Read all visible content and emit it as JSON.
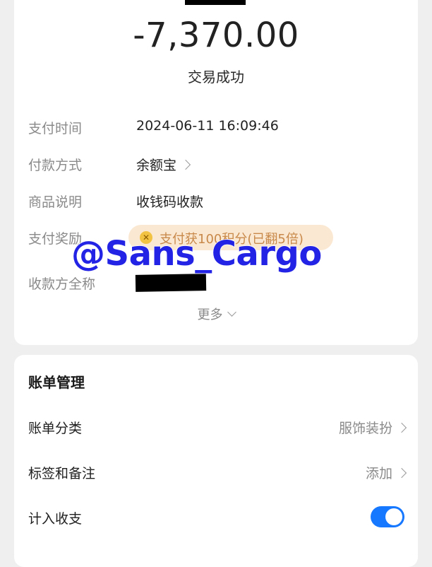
{
  "transaction": {
    "amount": "-7,370.00",
    "status": "交易成功"
  },
  "details": {
    "pay_time_label": "支付时间",
    "pay_time_value": "2024-06-11 16:09:46",
    "pay_method_label": "付款方式",
    "pay_method_value": "余额宝",
    "item_desc_label": "商品说明",
    "item_desc_value": "收钱码收款",
    "reward_label": "支付奖励",
    "reward_value": "支付获100积分(已翻5倍)",
    "payee_label": "收款方全称",
    "more_label": "更多"
  },
  "watermark": "@Sans_Cargo",
  "bill_management": {
    "title": "账单管理",
    "category_label": "账单分类",
    "category_value": "服饰装扮",
    "tags_label": "标签和备注",
    "tags_value": "添加",
    "count_label": "计入收支",
    "count_enabled": true
  },
  "colors": {
    "accent": "#1677ff",
    "watermark": "#2323e6",
    "reward_bg": "#fbe8d2",
    "reward_text": "#c8894a"
  }
}
